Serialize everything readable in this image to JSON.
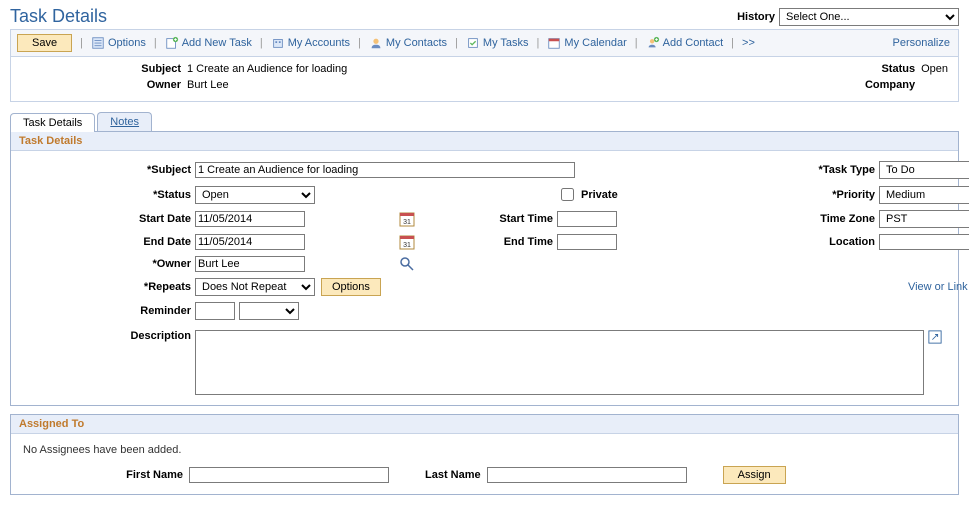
{
  "header": {
    "title": "Task Details",
    "history_label": "History",
    "history_value": "Select One..."
  },
  "toolbar": {
    "save": "Save",
    "options": "Options",
    "add_task": "Add New Task",
    "my_accounts": "My Accounts",
    "my_contacts": "My Contacts",
    "my_tasks": "My Tasks",
    "my_calendar": "My Calendar",
    "add_contact": "Add Contact",
    "more": ">>",
    "personalize": "Personalize"
  },
  "summary": {
    "subject_label": "Subject",
    "subject_value": "1 Create an Audience for loading",
    "owner_label": "Owner",
    "owner_value": "Burt Lee",
    "status_label": "Status",
    "status_value": "Open",
    "company_label": "Company",
    "company_value": ""
  },
  "tabs": {
    "task_details": "Task Details",
    "notes": "Notes"
  },
  "details": {
    "panel_title": "Task Details",
    "subject_label": "Subject",
    "subject_value": "1 Create an Audience for loading",
    "status_label": "Status",
    "status_value": "Open",
    "private_label": "Private",
    "tasktype_label": "Task Type",
    "tasktype_value": "To Do",
    "priority_label": "Priority",
    "priority_value": "Medium",
    "startdate_label": "Start Date",
    "startdate_value": "11/05/2014",
    "starttime_label": "Start Time",
    "starttime_value": "",
    "timezone_label": "Time Zone",
    "timezone_value": "PST",
    "enddate_label": "End Date",
    "enddate_value": "11/05/2014",
    "endtime_label": "End Time",
    "endtime_value": "",
    "location_label": "Location",
    "location_value": "",
    "owner_label": "Owner",
    "owner_value": "Burt Lee",
    "repeats_label": "Repeats",
    "repeats_value": "Does Not Repeat",
    "options_btn": "Options",
    "related_link": "View or Link Related Objects",
    "reminder_label": "Reminder",
    "reminder_value": "",
    "reminder_unit": "",
    "description_label": "Description",
    "description_value": ""
  },
  "assigned": {
    "panel_title": "Assigned To",
    "none_msg": "No Assignees have been added.",
    "firstname_label": "First Name",
    "firstname_value": "",
    "lastname_label": "Last Name",
    "lastname_value": "",
    "assign_btn": "Assign"
  }
}
